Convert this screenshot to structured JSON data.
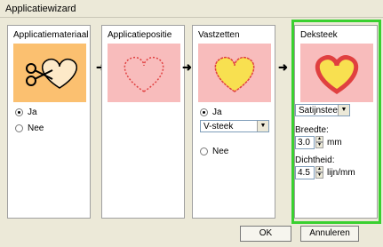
{
  "window": {
    "title": "Applicatiewizard"
  },
  "panels": {
    "material": {
      "title": "Applicatiemateriaal",
      "radio_yes": "Ja",
      "radio_no": "Nee"
    },
    "position": {
      "title": "Applicatiepositie"
    },
    "tack": {
      "title": "Vastzetten",
      "radio_yes": "Ja",
      "stitch_select": "V-steek",
      "radio_no": "Nee"
    },
    "cover": {
      "title": "Deksteek",
      "stitch_select": "Satijnsteek",
      "width_label": "Breedte:",
      "width_value": "3.0",
      "width_unit": "mm",
      "density_label": "Dichtheid:",
      "density_value": "4.5",
      "density_unit": "lijn/mm"
    }
  },
  "buttons": {
    "ok": "OK",
    "cancel": "Annuleren"
  },
  "colors": {
    "highlight": "#3ad030",
    "orange_bg": "#fbc070",
    "pink_bg": "#f8bcbc",
    "heart_red": "#e04040",
    "heart_yellow": "#f8e050"
  }
}
